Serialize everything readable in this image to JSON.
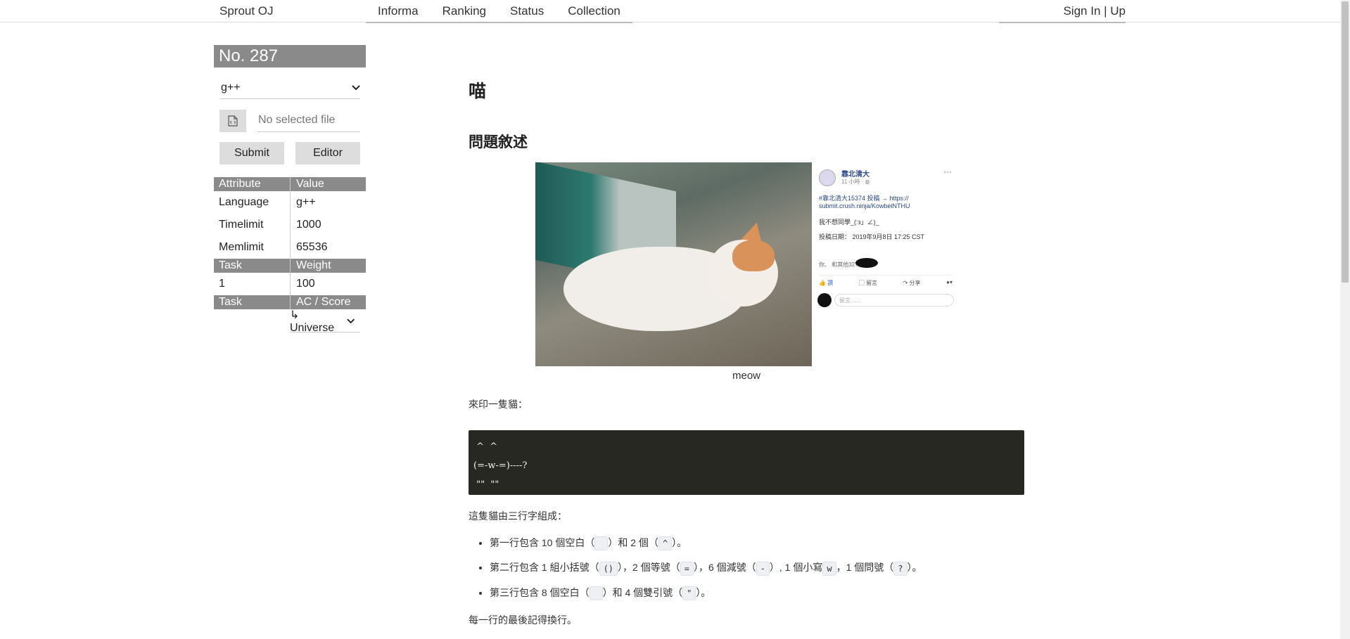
{
  "header": {
    "brand": "Sprout OJ",
    "nav": [
      "Informa",
      "Ranking",
      "Status",
      "Collection"
    ],
    "signin": "Sign In | Up"
  },
  "sidebar": {
    "problem_no": "No. 287",
    "language": "g++",
    "file_placeholder": "No selected file",
    "submit": "Submit",
    "editor": "Editor",
    "attr_header": [
      "Attribute",
      "Value"
    ],
    "attrs": [
      {
        "k": "Language",
        "v": "g++"
      },
      {
        "k": "Timelimit",
        "v": "1000"
      },
      {
        "k": "Memlimit",
        "v": "65536"
      }
    ],
    "task_header": [
      "Task",
      "Weight"
    ],
    "tasks": [
      {
        "k": "1",
        "v": "100"
      }
    ],
    "score_header": [
      "Task",
      "AC / Score"
    ],
    "universe": "↳ Universe"
  },
  "main": {
    "title": "喵",
    "subtitle": "問題敘述",
    "fb": {
      "name": "靠北清大",
      "time": "11 小時 · ◍",
      "more": "···",
      "link": "#靠北清大15374 投稿 → https:// submit.crush.ninja/KowbeiNTHU",
      "text": "我不想同學_(:з」∠)_",
      "date": "投稿日期： 2019年9月8日 17:25 CST",
      "react": "你、        和其他327人",
      "like": "讚",
      "comment": "留言",
      "share": "分享",
      "comment_placeholder": "留言……"
    },
    "caption": "meow",
    "intro": "來印一隻貓：",
    "code": " ^  ^\n(=-w-=)----?\n \"\"  \"\"",
    "desc": "這隻貓由三行字組成：",
    "li1": {
      "a": "第一行包含 10 個空白（",
      "c1": " ",
      "b": "）和 2 個（",
      "c2": "^",
      "d": "）。"
    },
    "li2": {
      "a": "第二行包含 1 組小括號（",
      "c1": "()",
      "b": "），2 個等號（",
      "c2": "=",
      "c": "），6 個減號（",
      "c3": "-",
      "d": "）, 1 個小寫",
      "c4": "w",
      "e": "，1 個問號（",
      "c5": "?",
      "f": "）。"
    },
    "li3": {
      "a": "第三行包含 8 個空白（",
      "c1": " ",
      "b": "）和 4 個雙引號（",
      "c2": "\"",
      "d": "）。"
    },
    "footer": "每一行的最後記得換行。"
  }
}
